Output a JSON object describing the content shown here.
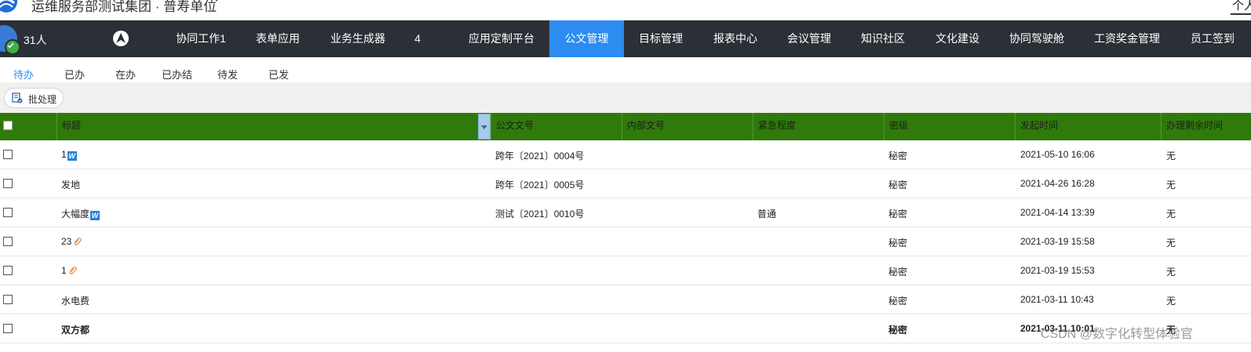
{
  "header": {
    "org_name": "运维服务部测试集团 · 普寿单位",
    "topright_text": "个人"
  },
  "nav": {
    "people_count": "31人",
    "items": [
      {
        "label": "协同工作1"
      },
      {
        "label": "表单应用"
      },
      {
        "label": "业务生成器"
      },
      {
        "label": "4"
      },
      {
        "label": "应用定制平台"
      },
      {
        "label": "公文管理",
        "active": true
      },
      {
        "label": "目标管理"
      },
      {
        "label": "报表中心"
      },
      {
        "label": "会议管理"
      },
      {
        "label": "知识社区"
      },
      {
        "label": "文化建设"
      },
      {
        "label": "协同驾驶舱"
      },
      {
        "label": "工资奖金管理"
      },
      {
        "label": "员工签到"
      }
    ],
    "active_color": "#2d8cf0"
  },
  "subtabs": [
    {
      "label": "待办",
      "active": true
    },
    {
      "label": "已办"
    },
    {
      "label": "在办"
    },
    {
      "label": "已办结"
    },
    {
      "label": "待发"
    },
    {
      "label": "已发"
    }
  ],
  "toolbar": {
    "batch_label": "批处理"
  },
  "table": {
    "header_color": "#2f7a0b",
    "columns": [
      "标题",
      "公文文号",
      "内部文号",
      "紧急程度",
      "密级",
      "发起时间",
      "办理剩余时间"
    ],
    "rows": [
      {
        "title": "1",
        "icon": "word-icon",
        "doc_no": "跨年〔2021〕0004号",
        "internal_no": "",
        "urgency": "",
        "secret": "秘密",
        "time": "2021-05-10 16:06",
        "remaining": "无"
      },
      {
        "title": "发地",
        "icon": "",
        "doc_no": "跨年〔2021〕0005号",
        "internal_no": "",
        "urgency": "",
        "secret": "秘密",
        "time": "2021-04-26 16:28",
        "remaining": "无"
      },
      {
        "title": "大幅度",
        "icon": "word-icon",
        "doc_no": "测试〔2021〕0010号",
        "internal_no": "",
        "urgency": "普通",
        "secret": "秘密",
        "time": "2021-04-14 13:39",
        "remaining": "无"
      },
      {
        "title": "23",
        "icon": "attachment-icon",
        "doc_no": "",
        "internal_no": "",
        "urgency": "",
        "secret": "秘密",
        "time": "2021-03-19 15:58",
        "remaining": "无"
      },
      {
        "title": "1",
        "icon": "attachment-icon",
        "doc_no": "",
        "internal_no": "",
        "urgency": "",
        "secret": "秘密",
        "time": "2021-03-19 15:53",
        "remaining": "无"
      },
      {
        "title": "水电费",
        "icon": "",
        "doc_no": "",
        "internal_no": "",
        "urgency": "",
        "secret": "秘密",
        "time": "2021-03-11 10:43",
        "remaining": "无"
      },
      {
        "title": "双方都",
        "icon": "",
        "doc_no": "",
        "internal_no": "",
        "urgency": "",
        "secret": "秘密",
        "time": "2021-03-11 10:01",
        "remaining": "无",
        "bold": true
      }
    ]
  },
  "watermark": "CSDN @数字化转型体验官"
}
